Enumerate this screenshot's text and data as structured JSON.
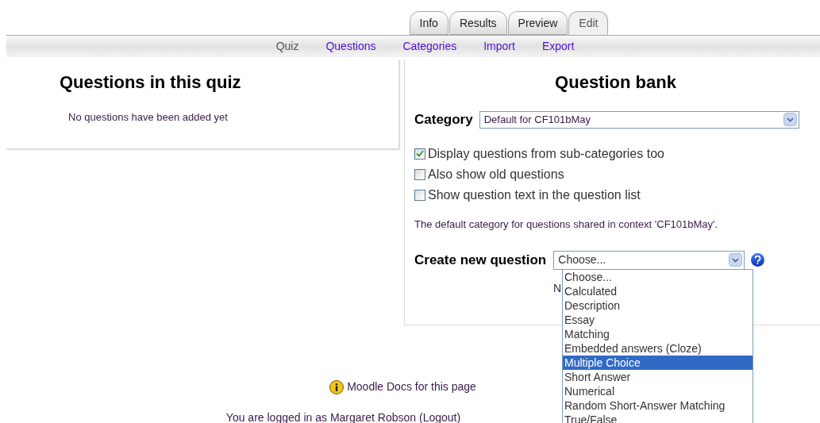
{
  "tabs": [
    {
      "label": "Info",
      "selected": false
    },
    {
      "label": "Results",
      "selected": false
    },
    {
      "label": "Preview",
      "selected": false
    },
    {
      "label": "Edit",
      "selected": true
    }
  ],
  "subtabs": [
    {
      "label": "Quiz",
      "selected": true
    },
    {
      "label": "Questions",
      "selected": false
    },
    {
      "label": "Categories",
      "selected": false
    },
    {
      "label": "Import",
      "selected": false
    },
    {
      "label": "Export",
      "selected": false
    }
  ],
  "quiz_panel": {
    "title": "Questions in this quiz",
    "message": "No questions have been added yet"
  },
  "bank_panel": {
    "title": "Question bank",
    "category_label": "Category",
    "category_value": "Default for CF101bMay",
    "options": [
      {
        "label": "Display questions from sub-categories too",
        "checked": true
      },
      {
        "label": "Also show old questions",
        "checked": false
      },
      {
        "label": "Show question text in the question list",
        "checked": false
      }
    ],
    "info": "The default category for questions shared in context 'CF101bMay'.",
    "create_label": "Create new question",
    "create_value": "Choose...",
    "hidden_text": "N",
    "dropdown": [
      {
        "label": "Choose...",
        "selected": false
      },
      {
        "label": "Calculated",
        "selected": false
      },
      {
        "label": "Description",
        "selected": false
      },
      {
        "label": "Essay",
        "selected": false
      },
      {
        "label": "Matching",
        "selected": false
      },
      {
        "label": "Embedded answers (Cloze)",
        "selected": false
      },
      {
        "label": "Multiple Choice",
        "selected": true
      },
      {
        "label": "Short Answer",
        "selected": false
      },
      {
        "label": "Numerical",
        "selected": false
      },
      {
        "label": "Random Short-Answer Matching",
        "selected": false
      },
      {
        "label": "True/False",
        "selected": false
      }
    ]
  },
  "footer": {
    "docs_link": "Moodle Docs for this page",
    "login_prefix": "You are logged in as",
    "user": "Margaret Robson",
    "logout": "(Logout)"
  }
}
